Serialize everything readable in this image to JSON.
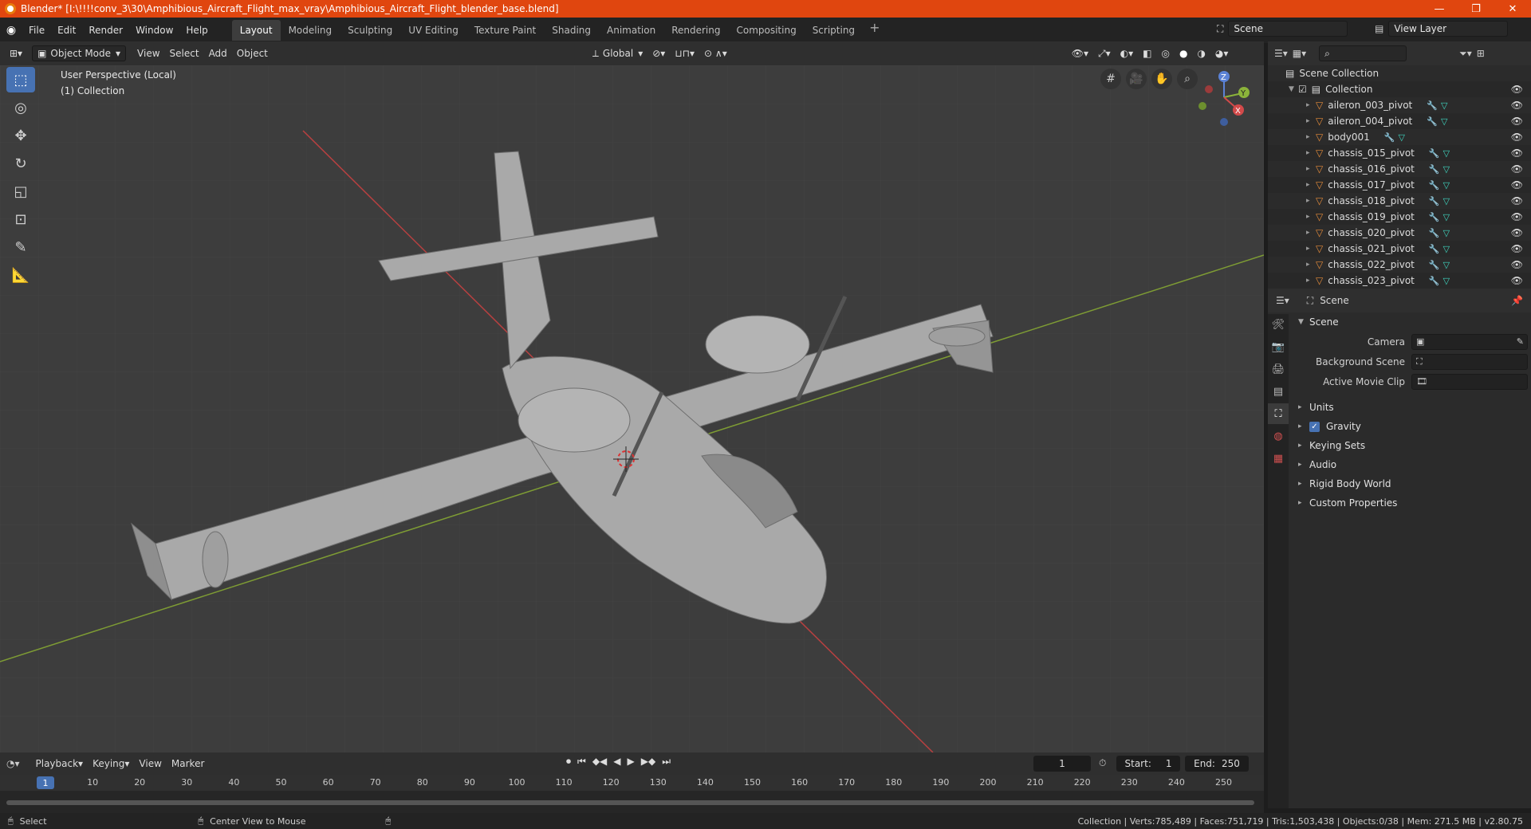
{
  "window": {
    "title": "Blender* [I:\\!!!!conv_3\\30\\Amphibious_Aircraft_Flight_max_vray\\Amphibious_Aircraft_Flight_blender_base.blend]",
    "controls": [
      "—",
      "❐",
      "✕"
    ]
  },
  "menubar": {
    "menus": [
      "File",
      "Edit",
      "Render",
      "Window",
      "Help"
    ],
    "workspaces": [
      "Layout",
      "Modeling",
      "Sculpting",
      "UV Editing",
      "Texture Paint",
      "Shading",
      "Animation",
      "Rendering",
      "Compositing",
      "Scripting"
    ],
    "active_workspace": "Layout",
    "scene": "Scene",
    "view_layer": "View Layer"
  },
  "viewport": {
    "mode": "Object Mode",
    "menus": [
      "View",
      "Select",
      "Add",
      "Object"
    ],
    "orientation": "Global",
    "info_line1": "User Perspective (Local)",
    "info_line2": "(1) Collection",
    "gizmo_axes": [
      "X",
      "Y",
      "Z"
    ]
  },
  "outliner": {
    "scene_collection": "Scene Collection",
    "collection": "Collection",
    "items": [
      "aileron_003_pivot",
      "aileron_004_pivot",
      "body001",
      "chassis_015_pivot",
      "chassis_016_pivot",
      "chassis_017_pivot",
      "chassis_018_pivot",
      "chassis_019_pivot",
      "chassis_020_pivot",
      "chassis_021_pivot",
      "chassis_022_pivot",
      "chassis_023_pivot"
    ]
  },
  "properties": {
    "header": "Scene",
    "section": "Scene",
    "fields": [
      {
        "label": "Camera",
        "value": ""
      },
      {
        "label": "Background Scene",
        "value": ""
      },
      {
        "label": "Active Movie Clip",
        "value": ""
      }
    ],
    "subsections": [
      "Units",
      "Gravity",
      "Keying Sets",
      "Audio",
      "Rigid Body World",
      "Custom Properties"
    ]
  },
  "timeline": {
    "menus": [
      "Playback",
      "Keying",
      "View",
      "Marker"
    ],
    "current_frame": "1",
    "start_label": "Start:",
    "start": "1",
    "end_label": "End:",
    "end": "250",
    "ticks": [
      "10",
      "20",
      "30",
      "40",
      "50",
      "60",
      "70",
      "80",
      "90",
      "100",
      "110",
      "120",
      "130",
      "140",
      "150",
      "160",
      "170",
      "180",
      "190",
      "200",
      "210",
      "220",
      "230",
      "240",
      "250"
    ]
  },
  "statusbar": {
    "select": "Select",
    "center": "Center View to Mouse",
    "stats": "Collection | Verts:785,489 | Faces:751,719 | Tris:1,503,438 | Objects:0/38 | Mem: 271.5 MB | v2.80.75"
  },
  "colors": {
    "title_bar": "#e0460f",
    "accent": "#4772b3",
    "viewport_bg": "#3d3d3d",
    "x_axis": "#cc3b3b",
    "y_axis": "#8bb33a"
  }
}
